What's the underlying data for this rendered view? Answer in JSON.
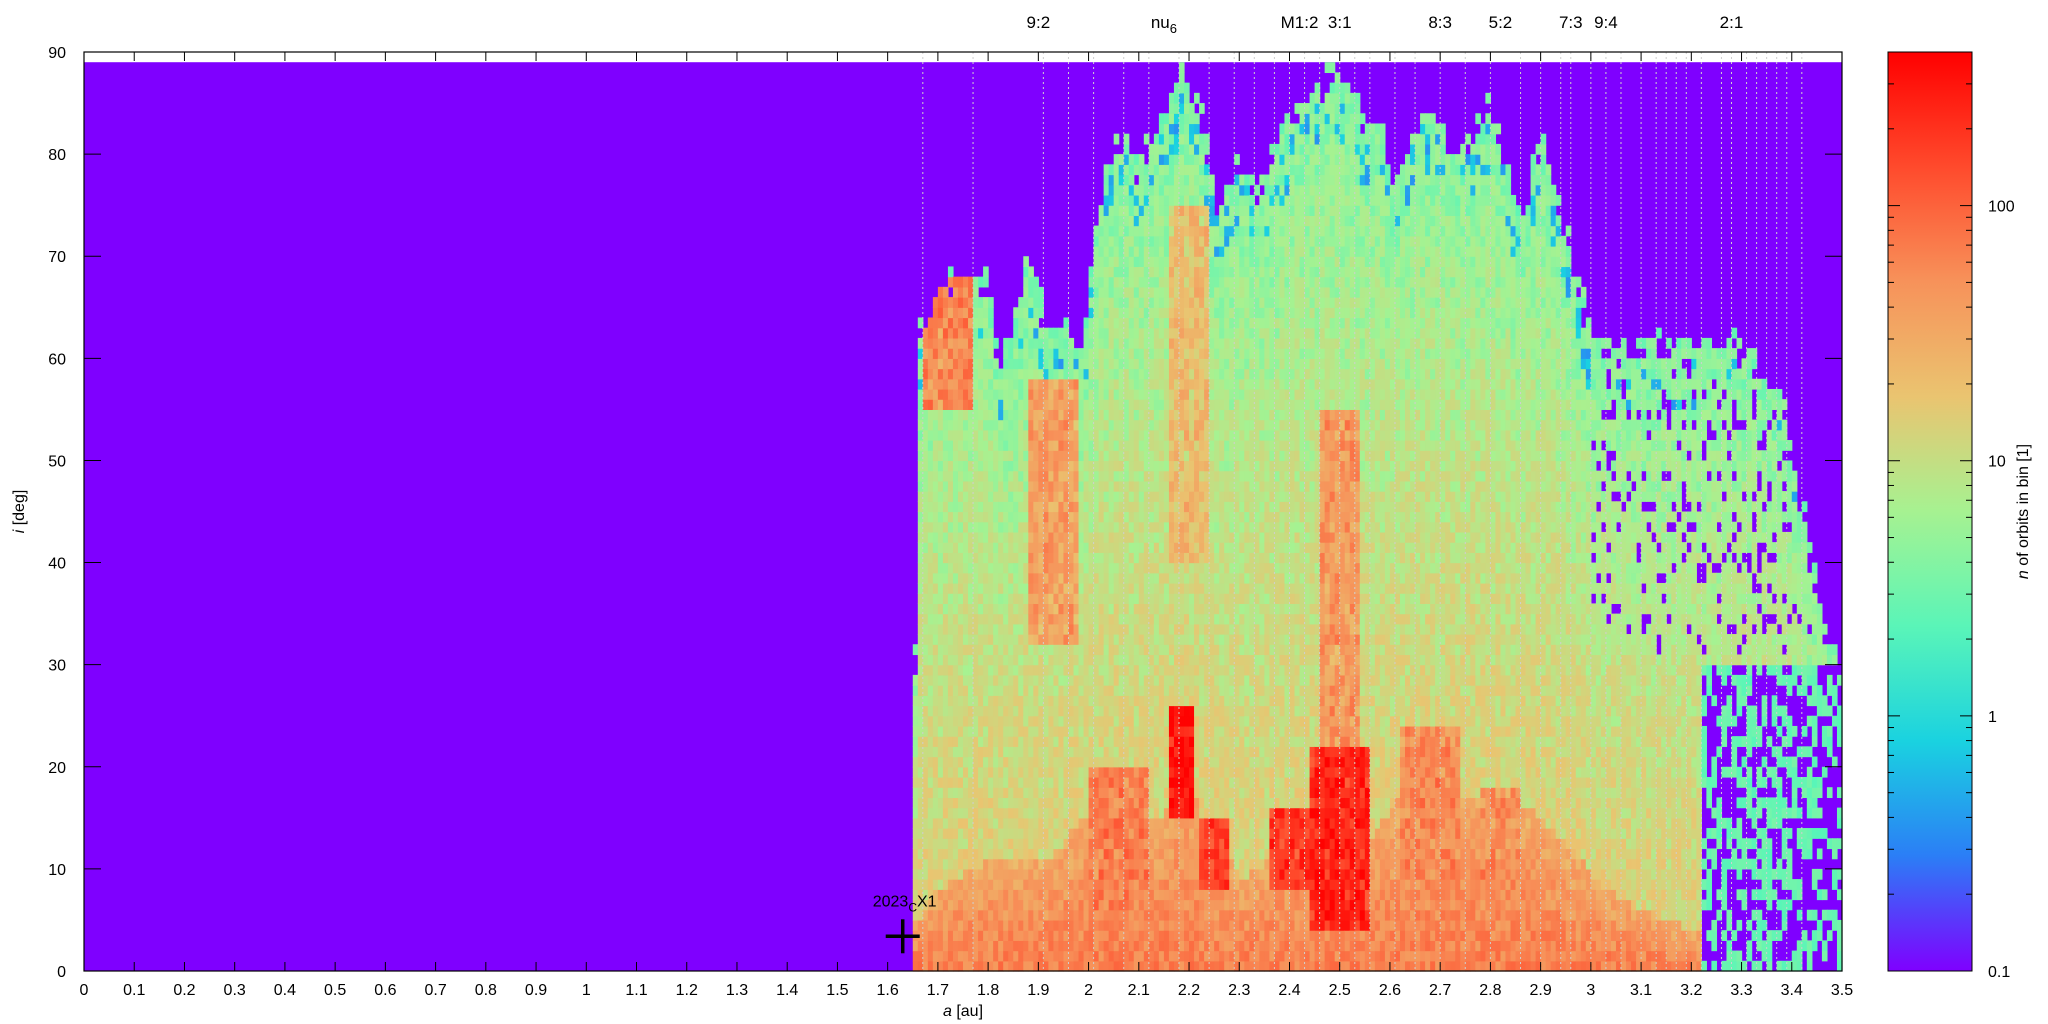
{
  "chart_data": {
    "type": "heatmap",
    "title": "",
    "xlabel": {
      "italic": "a",
      "rest": " [au]"
    },
    "ylabel": {
      "italic": "i",
      "rest": " [deg]"
    },
    "xlim": [
      0,
      3.5
    ],
    "ylim": [
      0,
      90
    ],
    "x_ticks": [
      "0",
      "0.1",
      "0.2",
      "0.3",
      "0.4",
      "0.5",
      "0.6",
      "0.7",
      "0.8",
      "0.9",
      "1",
      "1.1",
      "1.2",
      "1.3",
      "1.4",
      "1.5",
      "1.6",
      "1.7",
      "1.8",
      "1.9",
      "2",
      "2.1",
      "2.2",
      "2.3",
      "2.4",
      "2.5",
      "2.6",
      "2.7",
      "2.8",
      "2.9",
      "3",
      "3.1",
      "3.2",
      "3.3",
      "3.4",
      "3.5"
    ],
    "y_ticks": [
      "0",
      "10",
      "20",
      "30",
      "40",
      "50",
      "60",
      "70",
      "80",
      "90"
    ],
    "background_color": "#7f00ff",
    "colorbar": {
      "label": {
        "italic": "n",
        "rest": " of orbits in bin [1]"
      },
      "scale": "log",
      "range": [
        0.1,
        400
      ],
      "ticks": [
        {
          "value": 0.1,
          "label": "0.1"
        },
        {
          "value": 1,
          "label": "1"
        },
        {
          "value": 10,
          "label": "10"
        },
        {
          "value": 100,
          "label": "100"
        }
      ],
      "colors": [
        "#7f00ff",
        "#2b7ef6",
        "#1ad2e0",
        "#5af5b8",
        "#a6f291",
        "#eac470",
        "#f7925a",
        "#ff4a2c",
        "#ff0000"
      ]
    },
    "resonances": [
      {
        "label": "9:2",
        "a": 1.9
      },
      {
        "label": "nu",
        "sub": "6",
        "a": 2.15
      },
      {
        "label": "M1:2",
        "a": 2.42
      },
      {
        "label": "3:1",
        "a": 2.5
      },
      {
        "label": "8:3",
        "a": 2.7
      },
      {
        "label": "5:2",
        "a": 2.82
      },
      {
        "label": "7:3",
        "a": 2.96
      },
      {
        "label": "9:4",
        "a": 3.03
      },
      {
        "label": "2:1",
        "a": 3.28
      }
    ],
    "resonance_lines": [
      1.67,
      1.77,
      1.91,
      1.96,
      2.01,
      2.07,
      2.12,
      2.18,
      2.24,
      2.29,
      2.33,
      2.37,
      2.4,
      2.43,
      2.46,
      2.5,
      2.53,
      2.56,
      2.61,
      2.65,
      2.7,
      2.75,
      2.8,
      2.86,
      2.9,
      2.94,
      2.96,
      3.0,
      3.03,
      3.06,
      3.1,
      3.13,
      3.15,
      3.17,
      3.19,
      3.22,
      3.26,
      3.28,
      3.31,
      3.33,
      3.35,
      3.37,
      3.39,
      3.42
    ],
    "marker": {
      "label_main": "2023",
      "label_sub": "C",
      "label_tail": "X1",
      "a": 1.63,
      "i": 3.4
    },
    "bins": {
      "a_step": 0.01,
      "i_step": 1
    },
    "upper_edge": [
      [
        1.65,
        0
      ],
      [
        1.66,
        62
      ],
      [
        1.7,
        66
      ],
      [
        1.72,
        68
      ],
      [
        1.8,
        68
      ],
      [
        1.82,
        60
      ],
      [
        1.86,
        64
      ],
      [
        1.88,
        70
      ],
      [
        1.92,
        62
      ],
      [
        1.96,
        63
      ],
      [
        1.99,
        60
      ],
      [
        2.01,
        72
      ],
      [
        2.04,
        80
      ],
      [
        2.08,
        82
      ],
      [
        2.1,
        78
      ],
      [
        2.13,
        82
      ],
      [
        2.17,
        86
      ],
      [
        2.19,
        88
      ],
      [
        2.22,
        84
      ],
      [
        2.26,
        74
      ],
      [
        2.3,
        80
      ],
      [
        2.33,
        76
      ],
      [
        2.37,
        80
      ],
      [
        2.41,
        84
      ],
      [
        2.45,
        86
      ],
      [
        2.48,
        88
      ],
      [
        2.52,
        86
      ],
      [
        2.55,
        83
      ],
      [
        2.58,
        84
      ],
      [
        2.61,
        76
      ],
      [
        2.64,
        82
      ],
      [
        2.67,
        84
      ],
      [
        2.7,
        84
      ],
      [
        2.73,
        80
      ],
      [
        2.76,
        82
      ],
      [
        2.8,
        84
      ],
      [
        2.83,
        80
      ],
      [
        2.86,
        72
      ],
      [
        2.88,
        78
      ],
      [
        2.9,
        82
      ],
      [
        2.93,
        76
      ],
      [
        2.96,
        70
      ],
      [
        2.99,
        64
      ],
      [
        3.01,
        61
      ],
      [
        3.1,
        61
      ],
      [
        3.22,
        61
      ],
      [
        3.3,
        61
      ],
      [
        3.34,
        58
      ],
      [
        3.37,
        56
      ],
      [
        3.4,
        52
      ],
      [
        3.43,
        44
      ],
      [
        3.45,
        38
      ],
      [
        3.48,
        32
      ],
      [
        3.5,
        30
      ]
    ],
    "low_band": [
      [
        1.66,
        5
      ],
      [
        1.7,
        8
      ],
      [
        1.76,
        10
      ],
      [
        1.82,
        11
      ],
      [
        1.92,
        11
      ],
      [
        1.97,
        14
      ],
      [
        2.03,
        17
      ],
      [
        2.08,
        16
      ],
      [
        2.14,
        15
      ],
      [
        2.19,
        19
      ],
      [
        2.25,
        13
      ],
      [
        2.31,
        9
      ],
      [
        2.36,
        11
      ],
      [
        2.41,
        14
      ],
      [
        2.46,
        13
      ],
      [
        2.49,
        11
      ],
      [
        2.53,
        9
      ],
      [
        2.57,
        14
      ],
      [
        2.62,
        17
      ],
      [
        2.66,
        18
      ],
      [
        2.7,
        16
      ],
      [
        2.76,
        17
      ],
      [
        2.8,
        16
      ],
      [
        2.84,
        17
      ],
      [
        2.9,
        15
      ],
      [
        2.96,
        12
      ],
      [
        3.03,
        8
      ],
      [
        3.1,
        6
      ],
      [
        3.2,
        4
      ],
      [
        3.3,
        3
      ],
      [
        3.4,
        2
      ],
      [
        3.5,
        2
      ]
    ],
    "peak_regions": [
      {
        "a_range": [
          1.67,
          1.77
        ],
        "i_range": [
          55,
          68
        ],
        "level": 60
      },
      {
        "a_range": [
          1.88,
          1.98
        ],
        "i_range": [
          32,
          58
        ],
        "level": 40
      },
      {
        "a_range": [
          2.16,
          2.24
        ],
        "i_range": [
          40,
          75
        ],
        "level": 22
      },
      {
        "a_range": [
          2.16,
          2.21
        ],
        "i_range": [
          15,
          26
        ],
        "level": 350
      },
      {
        "a_range": [
          2.22,
          2.28
        ],
        "i_range": [
          8,
          15
        ],
        "level": 150
      },
      {
        "a_range": [
          2.36,
          2.44
        ],
        "i_range": [
          8,
          16
        ],
        "level": 200
      },
      {
        "a_range": [
          2.44,
          2.56
        ],
        "i_range": [
          4,
          22
        ],
        "level": 250
      },
      {
        "a_range": [
          2.46,
          2.54
        ],
        "i_range": [
          22,
          55
        ],
        "level": 45
      },
      {
        "a_range": [
          2.0,
          2.12
        ],
        "i_range": [
          6,
          20
        ],
        "level": 70
      },
      {
        "a_range": [
          2.62,
          2.74
        ],
        "i_range": [
          8,
          24
        ],
        "level": 60
      },
      {
        "a_range": [
          2.78,
          2.86
        ],
        "i_range": [
          8,
          18
        ],
        "level": 50
      }
    ],
    "grid": false,
    "legend": "colorbar-right"
  }
}
